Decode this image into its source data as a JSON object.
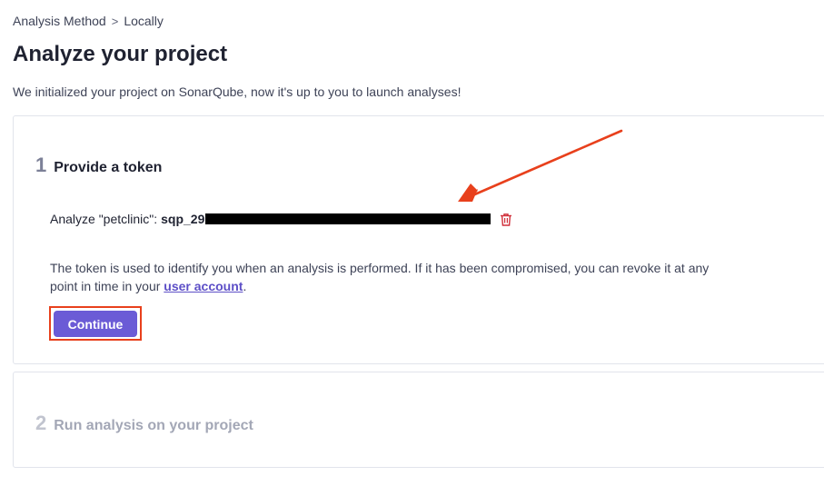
{
  "breadcrumb": {
    "item1": "Analysis Method",
    "separator": ">",
    "item2": "Locally"
  },
  "header": {
    "title": "Analyze your project",
    "subtitle": "We initialized your project on SonarQube, now it's up to you to launch analyses!"
  },
  "step1": {
    "number": "1",
    "title": "Provide a token",
    "token_label": "Analyze \"petclinic\":",
    "token_prefix": "sqp_29",
    "help_text": "The token is used to identify you when an analysis is performed. If it has been compromised, you can revoke it at any point in time in your",
    "help_link": "user account",
    "help_end": ".",
    "continue_label": "Continue"
  },
  "step2": {
    "number": "2",
    "title": "Run analysis on your project"
  },
  "icons": {
    "delete": "trash-icon",
    "annotation": "arrow-annotation"
  },
  "colors": {
    "accent": "#6b5bd6",
    "annotation": "#e8401c",
    "danger": "#d02f3a"
  }
}
